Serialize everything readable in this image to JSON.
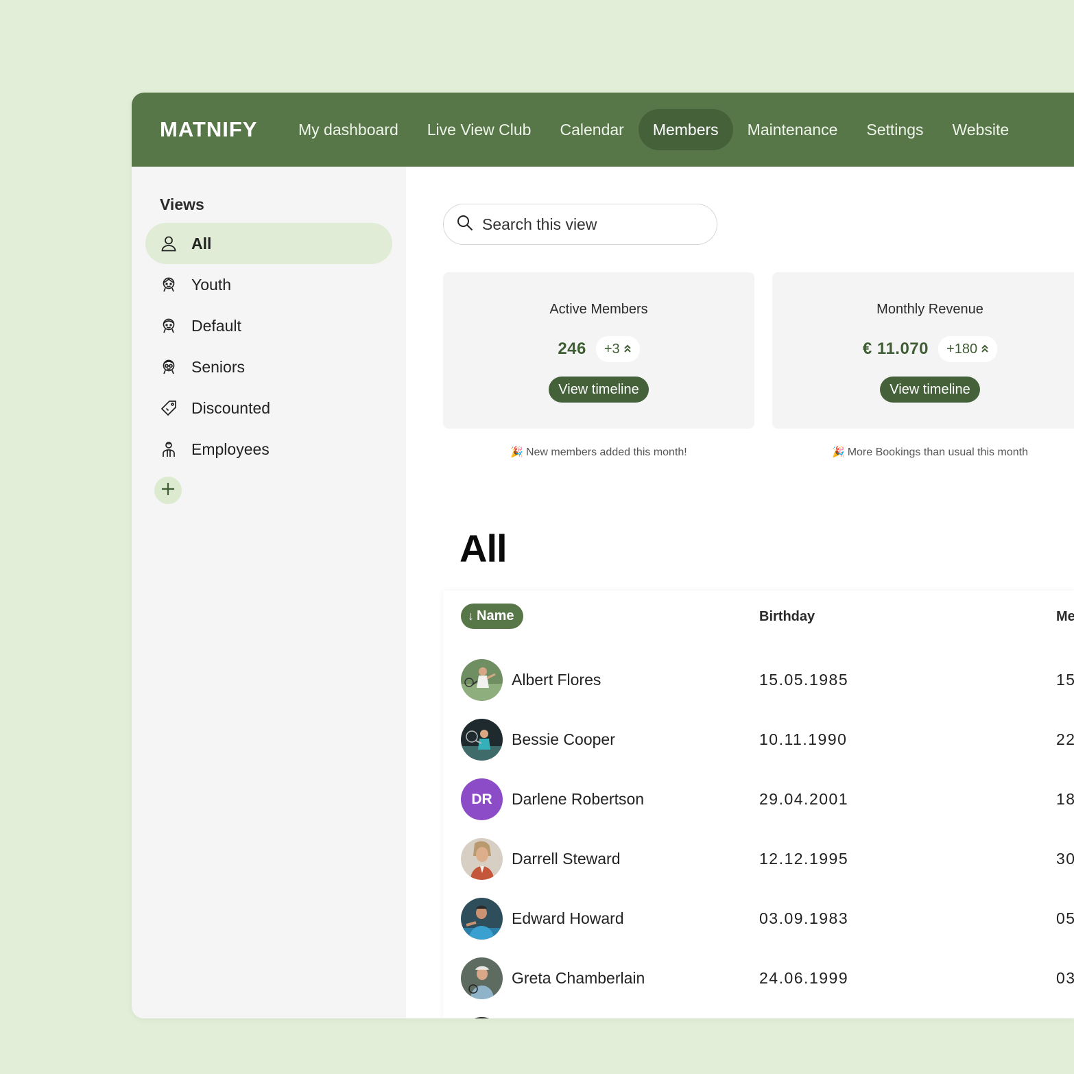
{
  "app": {
    "logo": "MATNIFY"
  },
  "nav": {
    "items": [
      {
        "label": "My dashboard",
        "active": false
      },
      {
        "label": "Live View Club",
        "active": false
      },
      {
        "label": "Calendar",
        "active": false
      },
      {
        "label": "Members",
        "active": true
      },
      {
        "label": "Maintenance",
        "active": false
      },
      {
        "label": "Settings",
        "active": false
      },
      {
        "label": "Website",
        "active": false
      }
    ]
  },
  "sidebar": {
    "title": "Views",
    "items": [
      {
        "label": "All",
        "icon": "person-icon",
        "active": true
      },
      {
        "label": "Youth",
        "icon": "youth-face-icon",
        "active": false
      },
      {
        "label": "Default",
        "icon": "default-face-icon",
        "active": false
      },
      {
        "label": "Seniors",
        "icon": "senior-face-icon",
        "active": false
      },
      {
        "label": "Discounted",
        "icon": "tag-icon",
        "active": false
      },
      {
        "label": "Employees",
        "icon": "employee-icon",
        "active": false
      }
    ],
    "add_icon": "plus-icon"
  },
  "search": {
    "placeholder": "Search this view",
    "value": ""
  },
  "cards": [
    {
      "title": "Active Members",
      "value": "246",
      "delta": "+3",
      "button": "View timeline",
      "note": "New members added this month!"
    },
    {
      "title": "Monthly Revenue",
      "value": "€ 11.070",
      "delta": "+180",
      "button": "View timeline",
      "note": "More Bookings than usual this month"
    }
  ],
  "view": {
    "heading": "All"
  },
  "table": {
    "columns": [
      "Name",
      "Birthday",
      "Me"
    ],
    "rows": [
      {
        "name": "Albert Flores",
        "birthday": "15.05.1985",
        "extra": "15",
        "avatar": "photo",
        "initials": ""
      },
      {
        "name": "Bessie Cooper",
        "birthday": "10.11.1990",
        "extra": "22",
        "avatar": "photo",
        "initials": ""
      },
      {
        "name": "Darlene Robertson",
        "birthday": "29.04.2001",
        "extra": "18",
        "avatar": "initials",
        "initials": "DR"
      },
      {
        "name": "Darrell Steward",
        "birthday": "12.12.1995",
        "extra": "30",
        "avatar": "photo",
        "initials": ""
      },
      {
        "name": "Edward Howard",
        "birthday": "03.09.1983",
        "extra": "05",
        "avatar": "photo",
        "initials": ""
      },
      {
        "name": "Greta Chamberlain",
        "birthday": "24.06.1999",
        "extra": "03",
        "avatar": "photo",
        "initials": ""
      }
    ]
  },
  "colors": {
    "brand": "#587749",
    "brand_dark": "#44613a",
    "background": "#e2eed8",
    "avatar_initials": "#8c4cc8"
  }
}
